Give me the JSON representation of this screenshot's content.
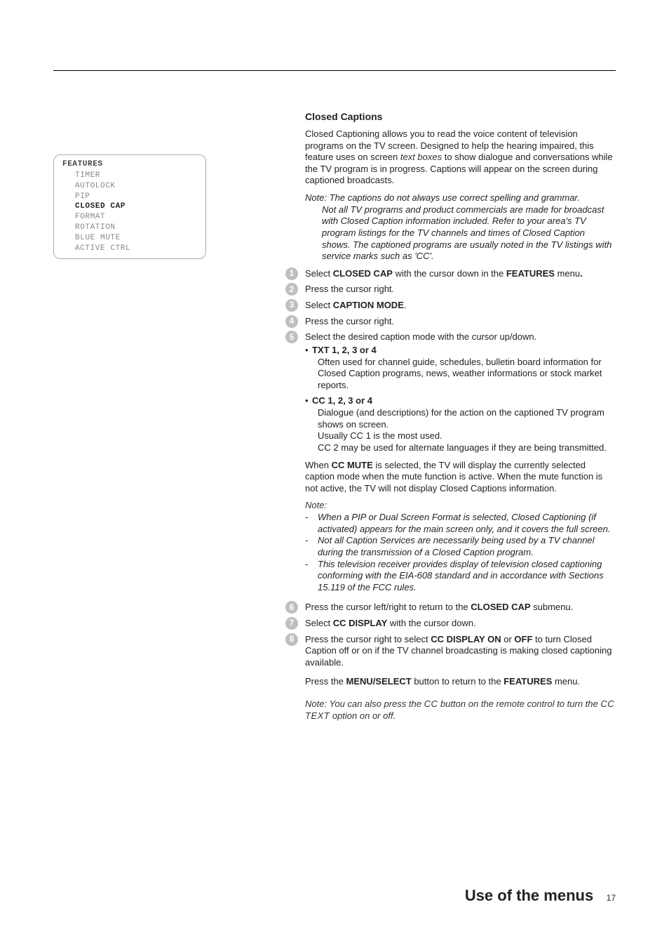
{
  "menu": {
    "title": "FEATURES",
    "items": [
      {
        "label": "TIMER",
        "selected": false
      },
      {
        "label": "AUTOLOCK",
        "selected": false
      },
      {
        "label": "PIP",
        "selected": false
      },
      {
        "label": "CLOSED CAP",
        "selected": true
      },
      {
        "label": "FORMAT",
        "selected": false
      },
      {
        "label": "ROTATION",
        "selected": false
      },
      {
        "label": "BLUE MUTE",
        "selected": false
      },
      {
        "label": "ACTIVE CTRL",
        "selected": false
      }
    ]
  },
  "heading": "Closed Captions",
  "intro1a": "Closed Captioning allows you to read the voice content of television programs on the TV screen. Designed to help the hearing impaired, this feature uses on screen ",
  "intro1_em": "text boxes",
  "intro1b": " to show dialogue and conversations while the TV program is in progress. Captions will appear on the screen during captioned broadcasts.",
  "note1_line1": "Note: The captions do not always use correct spelling and grammar.",
  "note1_line2": "Not all TV programs and product commercials are made for broadcast with Closed Caption information included. Refer to your area's TV program listings for the TV channels and times of Closed Caption shows. The captioned programs are usually noted in the TV listings with service marks such as 'CC'.",
  "step1a": "Select ",
  "step1_b": "CLOSED CAP",
  "step1b": " with the cursor down in the ",
  "step1_c": "FEATURES",
  "step1c": " menu",
  "step1d": ".",
  "step2a": "Press the cursor right",
  "step2b": ".",
  "step3a": "Select ",
  "step3_b": "CAPTION MODE",
  "step3b": ".",
  "step4": "Press the cursor right.",
  "step5": "Select the desired caption mode with the cursor up/down.",
  "bullet1_head": "TXT 1, 2, 3 or 4",
  "bullet1_body": "Often used for channel guide, schedules, bulletin board information for Closed Caption programs, news, weather informations or stock market reports.",
  "bullet2_head": "CC 1, 2, 3 or 4",
  "bullet2_body1": "Dialogue (and descriptions) for the action on the captioned TV program shows on screen.",
  "bullet2_body2": "Usually CC 1 is the most used.",
  "bullet2_body3": "CC 2 may be used for alternate languages if they are being transmitted.",
  "ccmute_a": "When ",
  "ccmute_b": "CC MUTE",
  "ccmute_c": " is selected, the TV will display the currently selected caption mode when the mute function is active. When the mute function is not active, the TV will not display Closed Captions information.",
  "note2_head": "Note:",
  "note2_1": "When a PIP or Dual Screen Format is selected, Closed Captioning (if activated) appears for the main screen only, and it covers the full screen.",
  "note2_2": "Not all Caption Services are necessarily being used by a TV channel during the transmission of a Closed Caption program.",
  "note2_3": "This television receiver provides display of television closed captioning conforming with the EIA-608 standard and in accordance with Sections 15.119 of the FCC rules.",
  "step6a": "Press the cursor left/right to return to the ",
  "step6_b": "CLOSED CAP",
  "step6b": " submenu.",
  "step7a": "Select ",
  "step7_b": "CC DISPLAY",
  "step7b": " with the cursor down.",
  "step8a": "Press the cursor right to select ",
  "step8_b": "CC DISPLAY ON",
  "step8b": " or ",
  "step8_c": "OFF",
  "step8c": " to turn Closed Caption off or on if the TV channel broadcasting is making closed captioning available.",
  "step_final_a": "Press the ",
  "step_final_b": "MENU/SELECT",
  "step_final_c": " button to return to the ",
  "step_final_d": "FEATURES",
  "step_final_e": " menu.",
  "note3a": "Note: You can also press the ",
  "note3_cc": "CC",
  "note3b": " button on the remote control to turn the ",
  "note3_cctext": "CC TEXT",
  "note3c": " option on or off.",
  "footer_title": "Use of the menus",
  "footer_page": "17"
}
